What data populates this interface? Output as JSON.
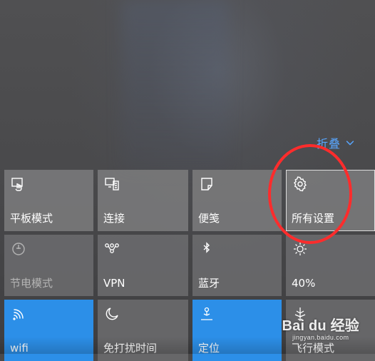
{
  "collapse_label": "折叠",
  "tiles": [
    {
      "label": "平板模式",
      "icon": "tablet-mode-icon",
      "state": "normal"
    },
    {
      "label": "连接",
      "icon": "connect-icon",
      "state": "normal"
    },
    {
      "label": "便笺",
      "icon": "note-icon",
      "state": "normal"
    },
    {
      "label": "所有设置",
      "icon": "gear-icon",
      "state": "normal"
    },
    {
      "label": "节电模式",
      "icon": "battery-saver-icon",
      "state": "disabled"
    },
    {
      "label": "VPN",
      "icon": "vpn-icon",
      "state": "normal"
    },
    {
      "label": "蓝牙",
      "icon": "bluetooth-icon",
      "state": "normal"
    },
    {
      "label": "40%",
      "icon": "brightness-icon",
      "state": "normal"
    },
    {
      "label": "wifi",
      "icon": "wifi-icon",
      "state": "active"
    },
    {
      "label": "免打扰时间",
      "icon": "moon-icon",
      "state": "normal"
    },
    {
      "label": "定位",
      "icon": "location-icon",
      "state": "active"
    },
    {
      "label": "飞行模式",
      "icon": "airplane-icon",
      "state": "normal"
    }
  ],
  "watermark": {
    "main": "Bai du 经验",
    "sub": "jingyan.baidu.com"
  },
  "colors": {
    "accent": "#2c8fe8",
    "highlight": "#ff2c2c",
    "link": "#58a6ff"
  }
}
